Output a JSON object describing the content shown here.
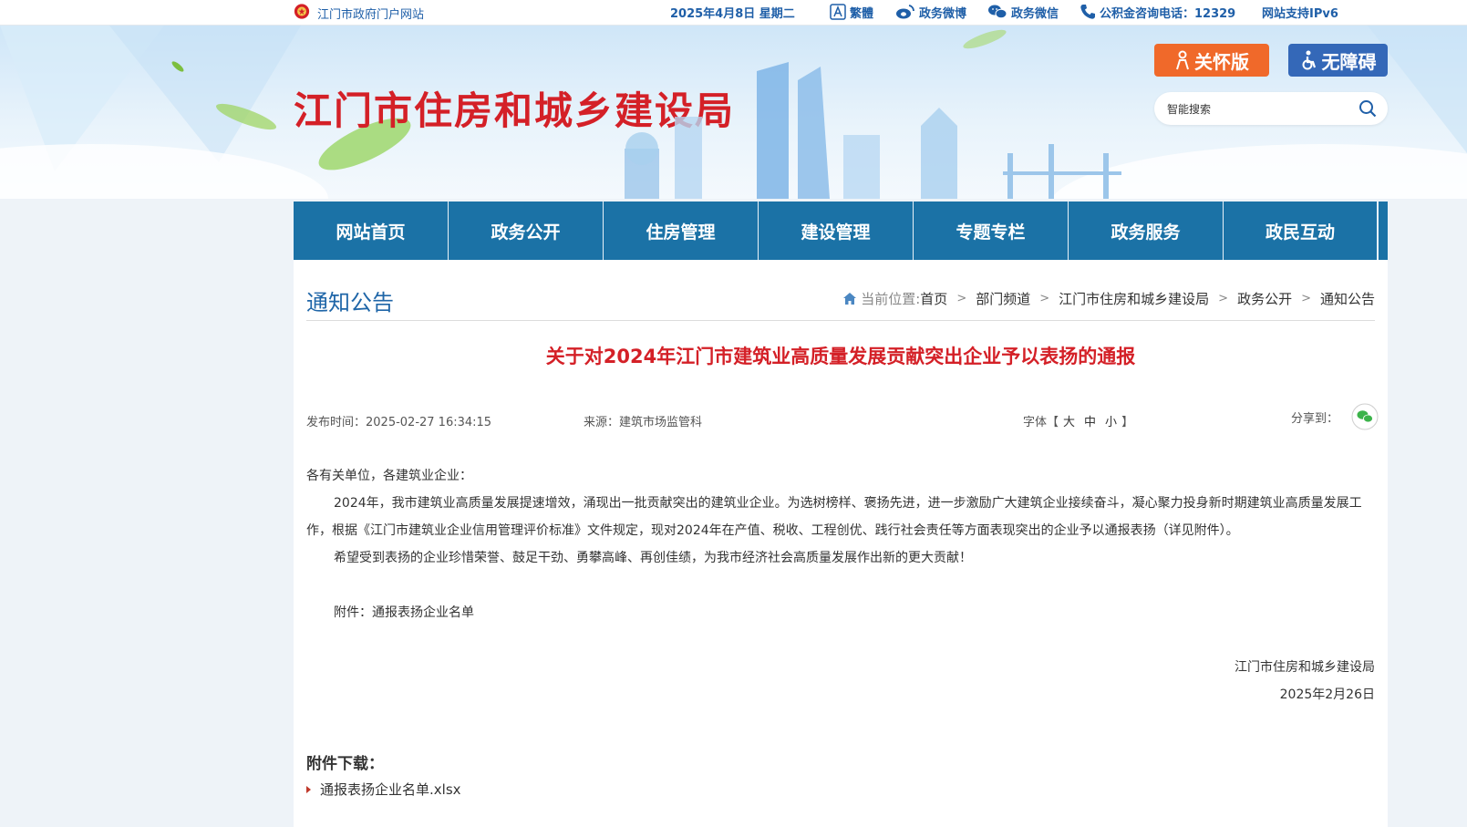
{
  "topbar": {
    "portal": "江门市政府门户网站",
    "date": "2025年4月8日 星期二",
    "fanti": "繁體",
    "weibo": "政务微博",
    "wechat": "政务微信",
    "phone": "公积金咨询电话：12329",
    "ipv6": "网站支持IPv6"
  },
  "header": {
    "site_title": "江门市住房和城乡建设局",
    "care_label": "关怀版",
    "access_label": "无障碍",
    "search_placeholder": "智能搜索"
  },
  "nav": {
    "items": [
      "网站首页",
      "政务公开",
      "住房管理",
      "建设管理",
      "专题专栏",
      "政务服务",
      "政民互动"
    ]
  },
  "content": {
    "section_title": "通知公告",
    "breadcrumb": {
      "label": "当前位置:",
      "items": [
        "首页",
        "部门频道",
        "江门市住房和城乡建设局",
        "政务公开",
        "通知公告"
      ]
    },
    "article_title": "关于对2024年江门市建筑业高质量发展贡献突出企业予以表扬的通报",
    "meta": {
      "date": "发布时间：2025-02-27 16:34:15",
      "source": "来源：建筑市场监管科",
      "font_label": "字体【",
      "font_large": "大",
      "font_medium": "中",
      "font_small": "小",
      "font_end": "】",
      "share_label": "分享到："
    },
    "body": {
      "greeting": "各有关单位，各建筑业企业：",
      "para1": "2024年，我市建筑业高质量发展提速增效，涌现出一批贡献突出的建筑业企业。为选树榜样、褒扬先进，进一步激励广大建筑企业接续奋斗，凝心聚力投身新时期建筑业高质量发展工作，根据《江门市建筑业企业信用管理评价标准》文件规定，现对2024年在产值、税收、工程创优、践行社会责任等方面表现突出的企业予以通报表扬（详见附件）。",
      "para2": "希望受到表扬的企业珍惜荣誉、鼓足干劲、勇攀高峰、再创佳绩，为我市经济社会高质量发展作出新的更大贡献！",
      "attachment_line": "附件：通报表扬企业名单",
      "signature": "江门市住房和城乡建设局",
      "sign_date": "2025年2月26日"
    },
    "attachments": {
      "title": "附件下载：",
      "file": "通报表扬企业名单.xlsx"
    }
  }
}
